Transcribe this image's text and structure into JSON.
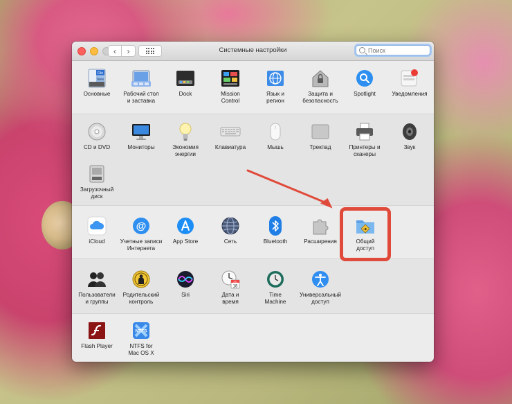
{
  "window": {
    "title": "Системные настройки"
  },
  "nav": {
    "back": "‹",
    "forward": "›"
  },
  "search": {
    "placeholder": "Поиск"
  },
  "rows": {
    "personal": [
      {
        "id": "general",
        "label": "Основные"
      },
      {
        "id": "desktop",
        "label": "Рабочий стол\nи заставка"
      },
      {
        "id": "dock",
        "label": "Dock"
      },
      {
        "id": "mission",
        "label": "Mission\nControl"
      },
      {
        "id": "language",
        "label": "Язык и\nрегион"
      },
      {
        "id": "security",
        "label": "Защита и\nбезопасность"
      },
      {
        "id": "spotlight",
        "label": "Spotlight"
      },
      {
        "id": "notifications",
        "label": "Уведомления"
      }
    ],
    "hardware": [
      {
        "id": "cd",
        "label": "CD и DVD"
      },
      {
        "id": "displays",
        "label": "Мониторы"
      },
      {
        "id": "energy",
        "label": "Экономия\nэнергии"
      },
      {
        "id": "keyboard",
        "label": "Клавиатура"
      },
      {
        "id": "mouse",
        "label": "Мышь"
      },
      {
        "id": "trackpad",
        "label": "Трекпад"
      },
      {
        "id": "printers",
        "label": "Принтеры и\nсканеры"
      },
      {
        "id": "sound",
        "label": "Звук"
      },
      {
        "id": "startup",
        "label": "Загрузочный\nдиск"
      }
    ],
    "internet": [
      {
        "id": "icloud",
        "label": "iCloud"
      },
      {
        "id": "accounts",
        "label": "Учетные записи\nИнтернета"
      },
      {
        "id": "appstore",
        "label": "App Store"
      },
      {
        "id": "network",
        "label": "Сеть"
      },
      {
        "id": "bluetooth",
        "label": "Bluetooth"
      },
      {
        "id": "extensions",
        "label": "Расширения"
      },
      {
        "id": "sharing",
        "label": "Общий\nдоступ"
      }
    ],
    "system": [
      {
        "id": "users",
        "label": "Пользователи\nи группы"
      },
      {
        "id": "parental",
        "label": "Родительский\nконтроль"
      },
      {
        "id": "siri",
        "label": "Siri"
      },
      {
        "id": "datetime",
        "label": "Дата и\nвремя"
      },
      {
        "id": "timemachine",
        "label": "Time\nMachine"
      },
      {
        "id": "accessibility",
        "label": "Универсальный\nдоступ"
      }
    ],
    "other": [
      {
        "id": "flash",
        "label": "Flash Player"
      },
      {
        "id": "ntfs",
        "label": "NTFS for\nMac OS X"
      }
    ]
  },
  "icon_texts": {
    "general_file": "File",
    "general_new": "New",
    "calendar_month": "JUL",
    "calendar_day": "18",
    "ntfs": "NTFS"
  },
  "colors": {
    "highlight": "#e04a3a",
    "accent": "#1e88ff"
  }
}
